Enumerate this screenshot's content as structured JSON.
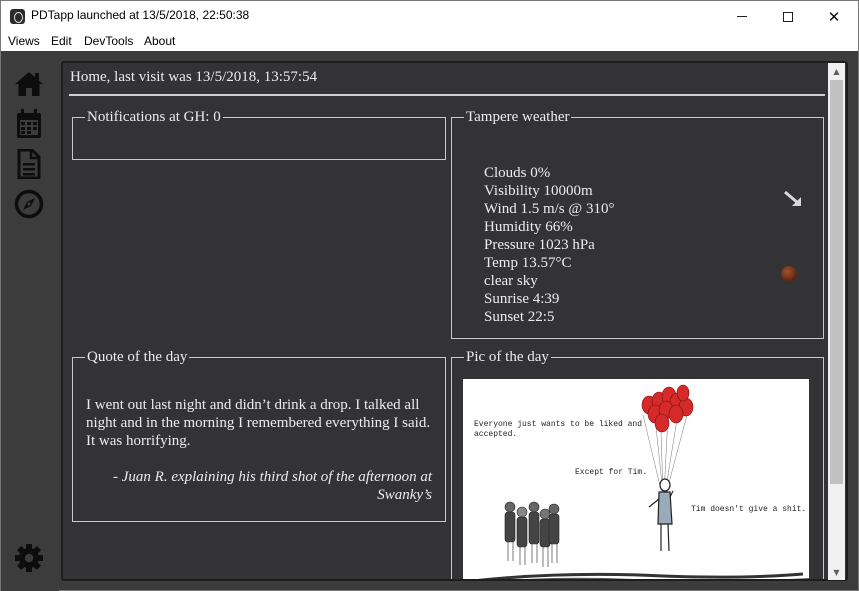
{
  "window": {
    "title": "PDTapp launched at 13/5/2018, 22:50:38",
    "close_glyph": "✕"
  },
  "menu": [
    "Views",
    "Edit",
    "DevTools",
    "About"
  ],
  "sidebar": {
    "icons": [
      "home-icon",
      "calendar-icon",
      "document-icon",
      "compass-icon"
    ],
    "settings_icon": "gear-icon"
  },
  "home": {
    "header": "Home, last visit was 13/5/2018, 13:57:54"
  },
  "notifications": {
    "legend": "Notifications at GH: 0"
  },
  "weather": {
    "legend": "Tampere weather",
    "lines": [
      "Clouds 0%",
      "Visibility 10000m",
      "Wind 1.5 m/s @ 310°",
      "Humidity 66%",
      "Pressure 1023 hPa",
      "Temp 13.57°C",
      "clear sky",
      "Sunrise 4:39",
      "Sunset 22:5"
    ],
    "wind_icon": "wind-direction-arrow-icon",
    "condition_icon": "clear-sky-icon"
  },
  "quote": {
    "legend": "Quote of the day",
    "text": "I went out last night and didn’t drink a drop. I talked all night and in the morning I remembered everything I said. It was horrifying.",
    "author": "- Juan R. explaining his third shot of the afternoon at Swanky’s"
  },
  "pic": {
    "legend": "Pic of the day",
    "captions": [
      "Everyone just wants to be liked and accepted.",
      "Except for Tim.",
      "Tim doesn't give a shit."
    ]
  },
  "colors": {
    "app_bg": "#3c3c3d",
    "panel_bg": "#333336",
    "text": "#ececec",
    "balloon_red": "#d42a2a"
  }
}
